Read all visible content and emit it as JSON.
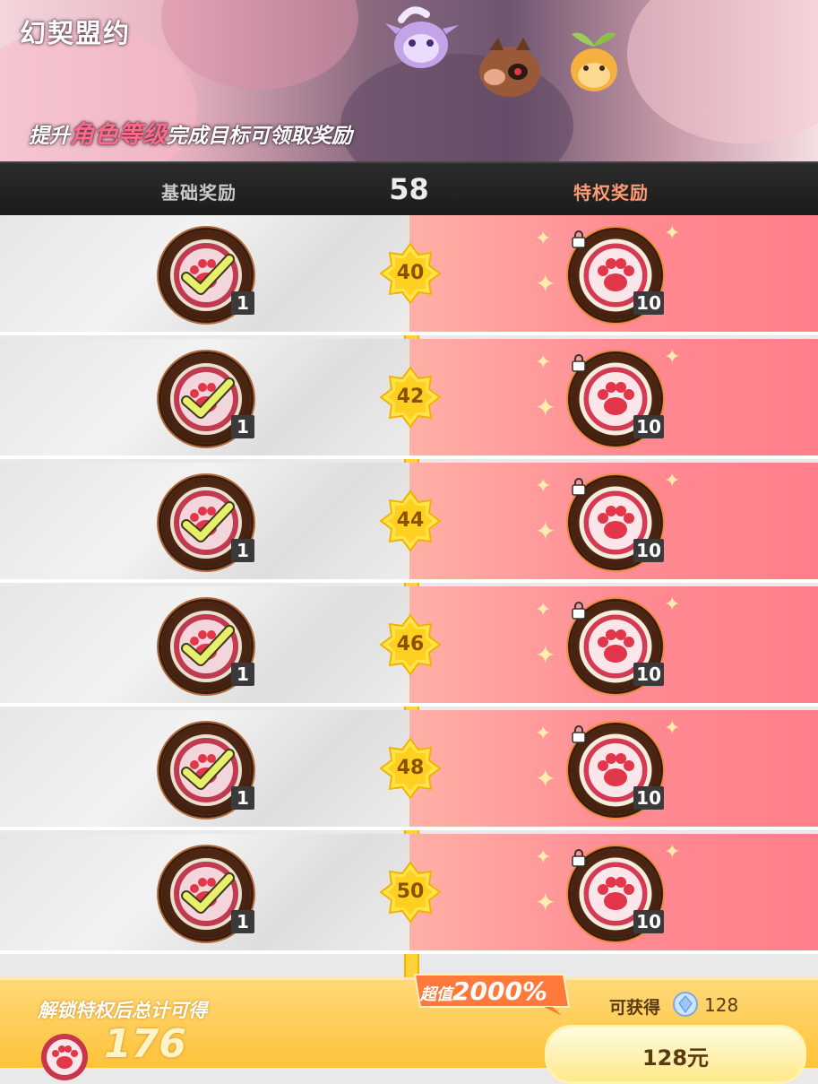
{
  "banner": {
    "title": "幻契盟约",
    "subtitle_pre": "提升",
    "subtitle_highlight": "角色等级",
    "subtitle_post": "完成目标可领取奖励"
  },
  "header": {
    "basic_label": "基础奖励",
    "current_level": "58",
    "premium_label": "特权奖励"
  },
  "rows": [
    {
      "level": "40",
      "basic_qty": "1",
      "premium_qty": "10",
      "premium_locked": true
    },
    {
      "level": "42",
      "basic_qty": "1",
      "premium_qty": "10",
      "premium_locked": true
    },
    {
      "level": "44",
      "basic_qty": "1",
      "premium_qty": "10",
      "premium_locked": true
    },
    {
      "level": "46",
      "basic_qty": "1",
      "premium_qty": "10",
      "premium_locked": true
    },
    {
      "level": "48",
      "basic_qty": "1",
      "premium_qty": "10",
      "premium_locked": true
    },
    {
      "level": "50",
      "basic_qty": "1",
      "premium_qty": "10",
      "premium_locked": true
    }
  ],
  "footer": {
    "unlock_label": "解锁特权后总计可得",
    "total": "176",
    "promo_text": "超值",
    "promo_value": "2000%",
    "can_get_label": "可获得",
    "gem_amount": "128",
    "buy_button": "128元"
  },
  "colors": {
    "premium_bg": "#ff8a92",
    "basic_bg": "#ececec",
    "track": "#ffd23a",
    "footer": "#ffc23a"
  },
  "icons": {
    "basic_reward": "claimed-check-badge-icon",
    "premium_reward": "paw-charm-icon",
    "lock": "lock-icon",
    "gem": "gem-icon"
  }
}
